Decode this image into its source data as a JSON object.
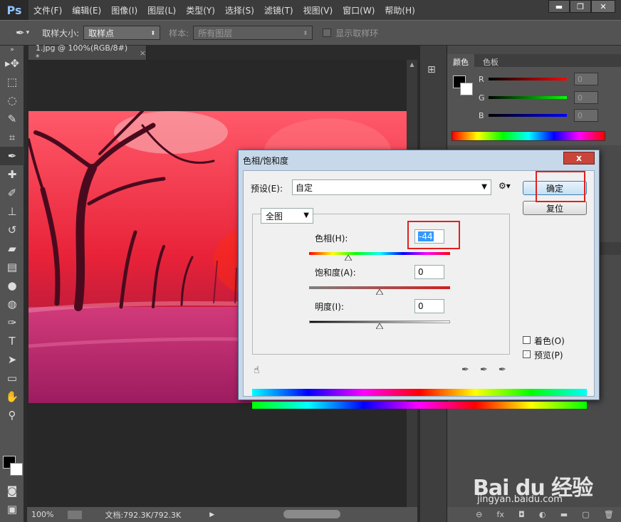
{
  "app": {
    "logo": "Ps",
    "menus": [
      "文件(F)",
      "编辑(E)",
      "图像(I)",
      "图层(L)",
      "类型(Y)",
      "选择(S)",
      "滤镜(T)",
      "视图(V)",
      "窗口(W)",
      "帮助(H)"
    ],
    "window_controls": {
      "minimize": "▬",
      "restore": "❐",
      "close": "✕"
    }
  },
  "options": {
    "sample_size_label": "取样大小:",
    "sample_size_value": "取样点",
    "sample_label": "样本:",
    "sample_value": "所有图层",
    "show_ring_label": "显示取样环"
  },
  "document": {
    "tab_title": "1.jpg @ 100%(RGB/8#) *",
    "tab_close": "×",
    "zoom": "100%",
    "doc_info": "文档:792.3K/792.3K"
  },
  "panels": {
    "tabs": [
      "颜色",
      "色板"
    ],
    "sliders": [
      {
        "label": "R",
        "value": "0",
        "color": "#ff0000"
      },
      {
        "label": "G",
        "value": "0",
        "color": "#00ff00"
      },
      {
        "label": "B",
        "value": "0",
        "color": "#0000ff"
      }
    ]
  },
  "dialog": {
    "title": "色相/饱和度",
    "close": "x",
    "preset_label": "预设(E):",
    "preset_value": "自定",
    "ok_label": "确定",
    "reset_label": "复位",
    "channel_value": "全图",
    "hue_label": "色相(H):",
    "hue_value": "-44",
    "saturation_label": "饱和度(A):",
    "saturation_value": "0",
    "lightness_label": "明度(I):",
    "lightness_value": "0",
    "colorize_label": "着色(O)",
    "colorize_checked": false,
    "preview_label": "预览(P)",
    "preview_checked": true,
    "hue_level": 0.28,
    "saturation_level": 0.5,
    "lightness_level": 0.5
  },
  "watermark": {
    "logo": "Bai du 经验",
    "url": "jingyan.baidu.com"
  }
}
